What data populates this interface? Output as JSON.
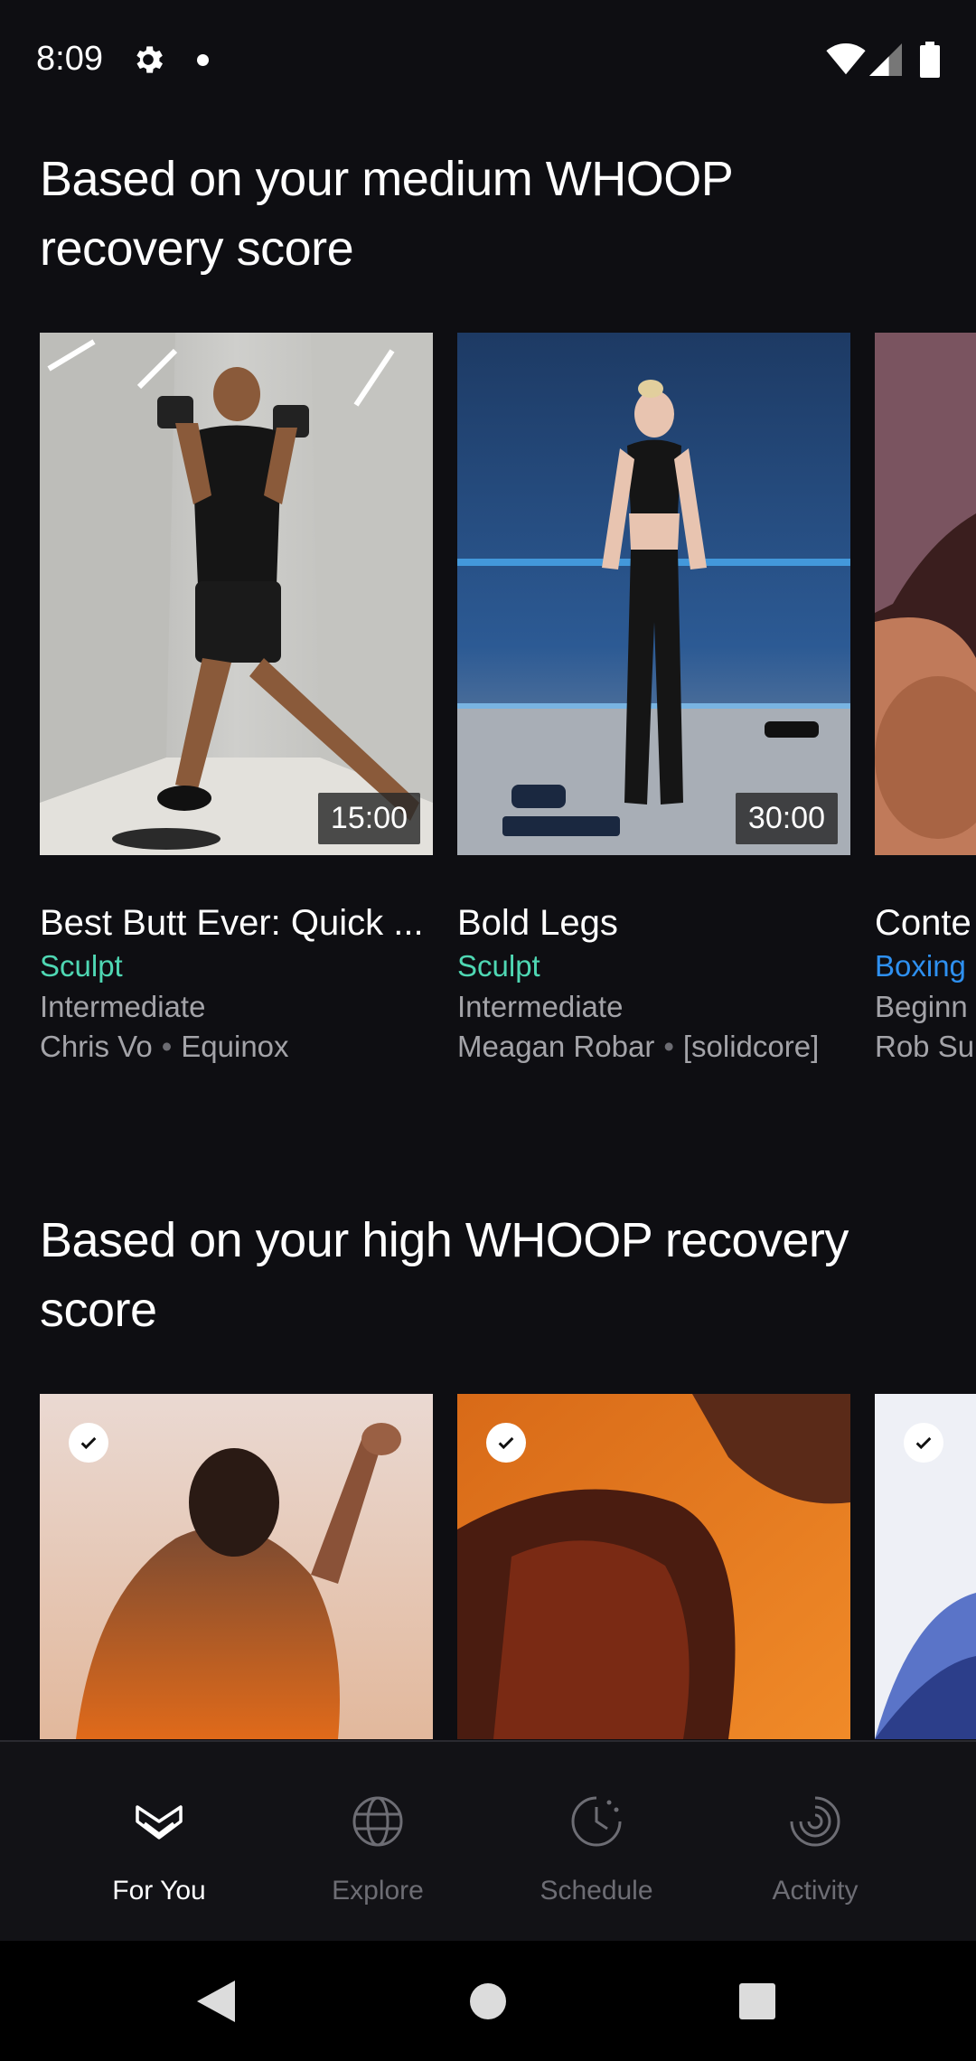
{
  "status_bar": {
    "time": "8:09",
    "icons": [
      "gear-icon",
      "notification-dot-icon",
      "wifi-icon",
      "cell-signal-icon",
      "battery-icon"
    ]
  },
  "sections": [
    {
      "title": "Based on your medium WHOOP recovery score",
      "cards": [
        {
          "title": "Best Butt Ever: Quick ...",
          "duration": "15:00",
          "category": "Sculpt",
          "level": "Intermediate",
          "trainer": "Chris Vo",
          "studio": "Equinox"
        },
        {
          "title": "Bold Legs",
          "duration": "30:00",
          "category": "Sculpt",
          "level": "Intermediate",
          "trainer": "Meagan Robar",
          "studio": "[solidcore]"
        },
        {
          "title": "Conte",
          "category": "Boxing",
          "level": "Beginn",
          "trainer": "Rob Su"
        }
      ]
    },
    {
      "title": "Based on your high WHOOP recovery score",
      "cards": [
        {
          "checked": true
        },
        {
          "checked": true
        },
        {
          "checked": true
        }
      ]
    }
  ],
  "bottom_nav": {
    "items": [
      {
        "label": "For You",
        "icon": "whoop-heart-icon",
        "active": true
      },
      {
        "label": "Explore",
        "icon": "globe-icon",
        "active": false
      },
      {
        "label": "Schedule",
        "icon": "clock-icon",
        "active": false
      },
      {
        "label": "Activity",
        "icon": "activity-spiral-icon",
        "active": false
      }
    ]
  },
  "colors": {
    "background": "#0e0e12",
    "sculpt_teal": "#4fd7b3",
    "boxing_blue": "#2e90f0",
    "secondary_text": "#a3a3a8",
    "nav_inactive": "#6d6d74"
  }
}
